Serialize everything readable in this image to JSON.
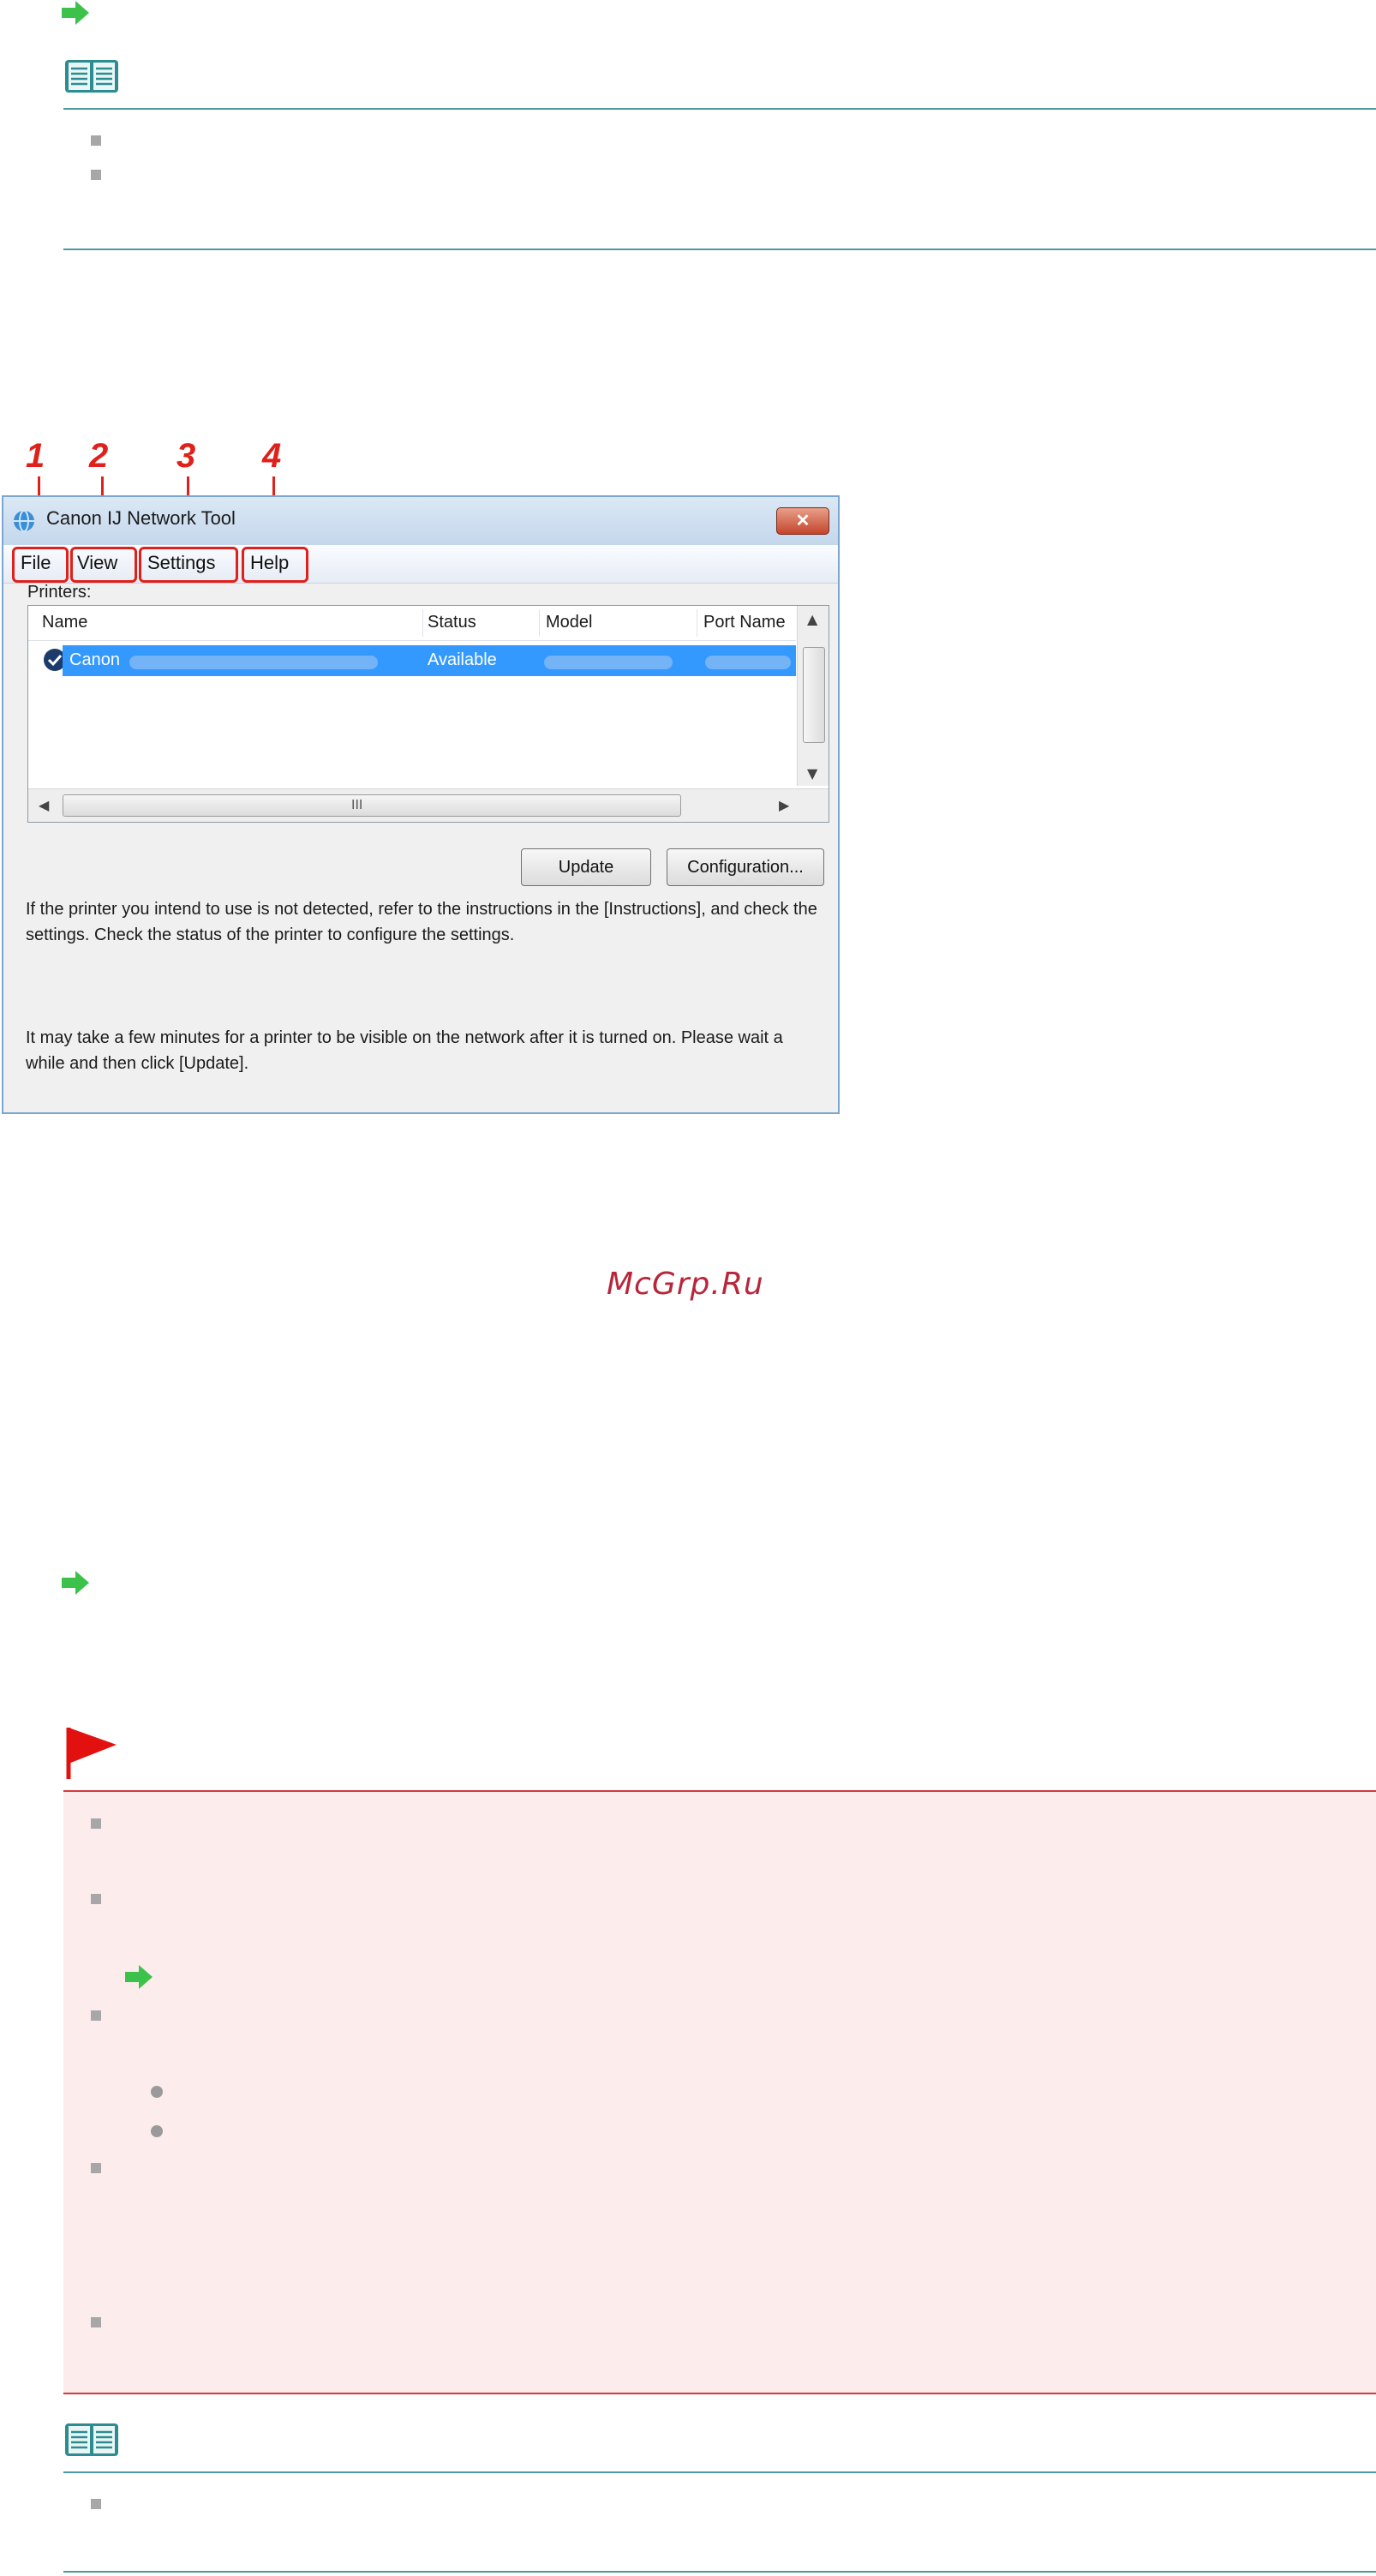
{
  "window": {
    "title": "Canon IJ Network Tool",
    "close_glyph": "✕",
    "menus": [
      "File",
      "View",
      "Settings",
      "Help"
    ],
    "callouts": [
      "1",
      "2",
      "3",
      "4"
    ],
    "printers_label": "Printers:",
    "columns": [
      "Name",
      "Status",
      "Model",
      "Port Name"
    ],
    "row": {
      "name": "Canon",
      "status": "Available"
    },
    "hscroll_grip": "III",
    "buttons": {
      "update": "Update",
      "configuration": "Configuration..."
    },
    "info_text_1": "If the printer you intend to use is not detected, refer to the instructions in the [Instructions], and check the settings. Check the status of the printer to configure the settings.",
    "info_text_2": "It may take a few minutes for a printer to be visible on the network after it is turned on. Please wait a while and then click [Update]."
  },
  "watermark": "McGrp.Ru",
  "colors": {
    "teal_rule": "#4a9aa0",
    "red_rule": "#d23a3a",
    "caution_bg": "#fdecec",
    "callout_red": "#e0201a",
    "arrow_green": "#3cc24a",
    "selection_blue": "#3399ff"
  },
  "icons": {
    "link_arrow": "green-arrow-icon",
    "note": "note-book-icon",
    "caution": "red-flag-icon"
  }
}
